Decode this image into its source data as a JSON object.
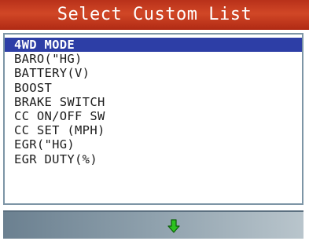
{
  "title": "Select Custom List",
  "list": {
    "selected_index": 0,
    "items": [
      "4WD MODE",
      "BARO(\"HG)",
      "BATTERY(V)",
      "BOOST",
      "BRAKE SWITCH",
      "CC ON/OFF SW",
      "CC SET (MPH)",
      "EGR(\"HG)",
      "EGR DUTY(%)"
    ]
  },
  "bottom_bar": {
    "icon": "green-down-arrow-icon",
    "arrow_color": "#2cc21e"
  },
  "colors": {
    "title_bar": "#c23c1e",
    "selection": "#2d3ea6",
    "frame": "#7d95a6"
  }
}
